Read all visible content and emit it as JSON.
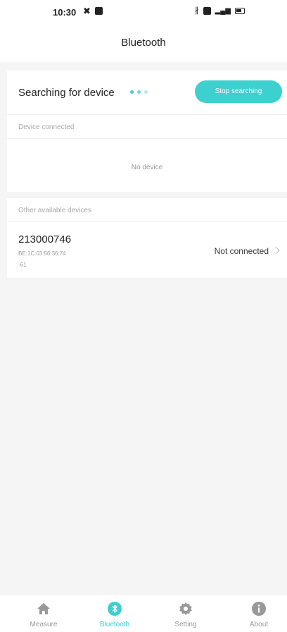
{
  "status_bar": {
    "time": "10:30"
  },
  "header": {
    "title": "Bluetooth"
  },
  "search": {
    "label": "Searching for device",
    "stop_button": "Stop searching"
  },
  "sections": {
    "connected_label": "Device connected",
    "no_device": "No device",
    "available_label": "Other available devices"
  },
  "devices": [
    {
      "name": "213000746",
      "mac": "BE:1C:03:56:36:74",
      "rssi": "-61",
      "status": "Not connected"
    }
  ],
  "tabs": [
    {
      "label": "Measure",
      "icon": "home-icon",
      "active": false
    },
    {
      "label": "Bluetooth",
      "icon": "bluetooth-icon",
      "active": true
    },
    {
      "label": "Setting",
      "icon": "gear-icon",
      "active": false
    },
    {
      "label": "About",
      "icon": "info-icon",
      "active": false
    }
  ],
  "colors": {
    "accent": "#3ecfcf",
    "background": "#f5f5f5"
  }
}
